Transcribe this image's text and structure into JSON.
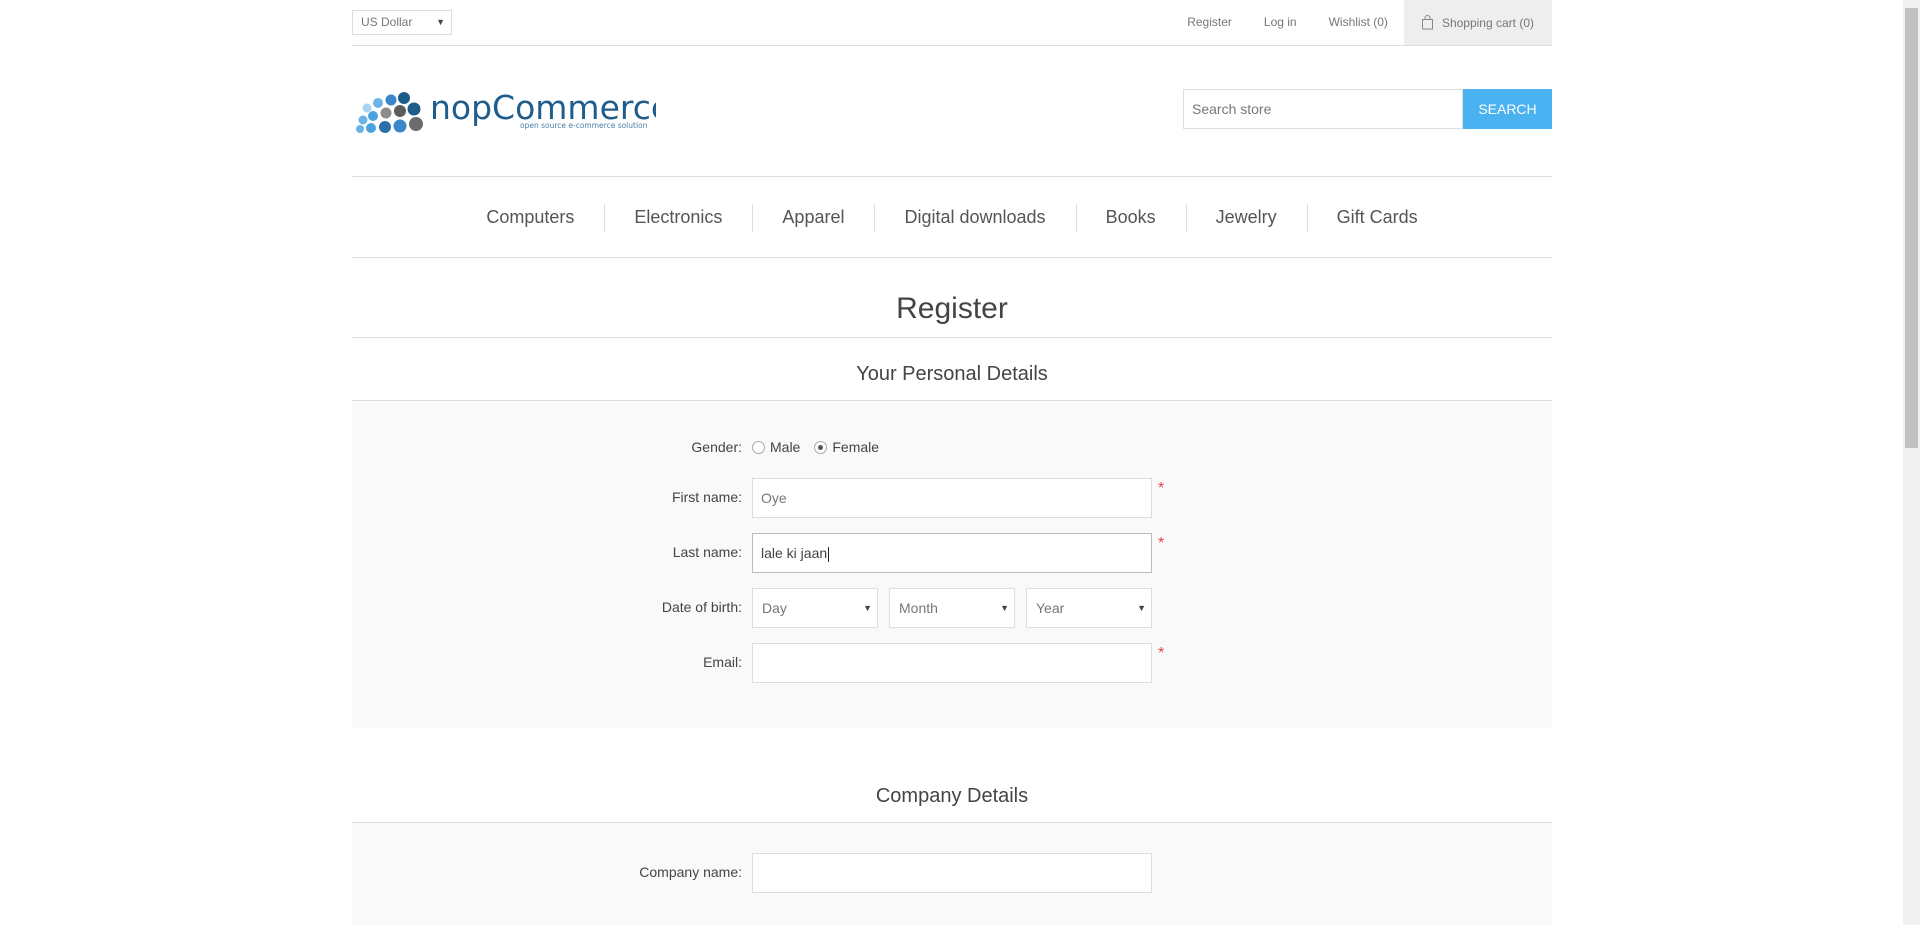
{
  "header": {
    "currency": "US Dollar",
    "links": {
      "register": "Register",
      "login": "Log in",
      "wishlist": "Wishlist (0)",
      "cart": "Shopping cart (0)"
    }
  },
  "logo": {
    "brand": "nopCommerce",
    "tagline": "open source e-commerce solution"
  },
  "search": {
    "placeholder": "Search store",
    "button": "Search"
  },
  "menu": {
    "items": [
      "Computers",
      "Electronics",
      "Apparel",
      "Digital downloads",
      "Books",
      "Jewelry",
      "Gift Cards"
    ]
  },
  "page": {
    "title": "Register"
  },
  "personal": {
    "title": "Your Personal Details",
    "gender_label": "Gender:",
    "gender_options": [
      "Male",
      "Female"
    ],
    "gender_selected": "Female",
    "first_name_label": "First name:",
    "first_name_value": "Oye",
    "last_name_label": "Last name:",
    "last_name_value": "lale ki jaan",
    "dob_label": "Date of birth:",
    "dob_day": "Day",
    "dob_month": "Month",
    "dob_year": "Year",
    "email_label": "Email:",
    "email_value": "",
    "required_mark": "*"
  },
  "company": {
    "title": "Company Details",
    "name_label": "Company name:",
    "name_value": ""
  },
  "colors": {
    "accent": "#4ab2f1",
    "required": "#e4444c",
    "field_bg": "#f9f9f9"
  }
}
